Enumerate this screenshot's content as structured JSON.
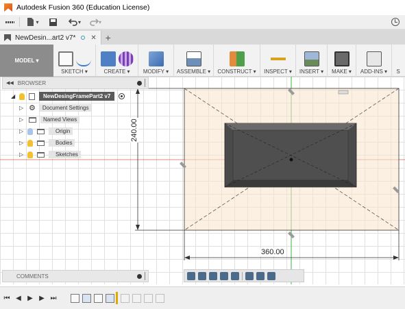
{
  "titlebar": {
    "title": "Autodesk Fusion 360 (Education License)"
  },
  "document_tab": {
    "label": "NewDesin...art2 v7*",
    "close": "✕",
    "add": "+"
  },
  "toolbar": {
    "workspace": "MODEL ▾",
    "groups": [
      {
        "label": "SKETCH ▾"
      },
      {
        "label": "CREATE ▾"
      },
      {
        "label": "MODIFY ▾"
      },
      {
        "label": "ASSEMBLE ▾"
      },
      {
        "label": "CONSTRUCT ▾"
      },
      {
        "label": "INSPECT ▾"
      },
      {
        "label": "INSERT ▾"
      },
      {
        "label": "MAKE ▾"
      },
      {
        "label": "ADD-INS ▾"
      },
      {
        "label": "S"
      }
    ]
  },
  "browser": {
    "title": "BROWSER",
    "root": "NewDesingFramePart2 v7",
    "items": [
      {
        "label": "Document Settings"
      },
      {
        "label": "Named Views"
      },
      {
        "label": "Origin"
      },
      {
        "label": "Bodies"
      },
      {
        "label": "Sketches"
      }
    ]
  },
  "canvas": {
    "dimension_vertical": "240.00",
    "dimension_horizontal": "360.00"
  },
  "comments": {
    "title": "COMMENTS"
  },
  "colors": {
    "accent_orange": "#e8a050",
    "body_dark": "#4a4a4a",
    "axis_green": "#3cb043",
    "axis_red": "#d04020"
  },
  "icons": {
    "app": "fusion-logo-icon",
    "grid": "data-panel-icon",
    "file": "file-icon",
    "save": "save-icon",
    "undo": "undo-icon",
    "redo": "redo-icon",
    "job_status": "job-status-icon"
  }
}
